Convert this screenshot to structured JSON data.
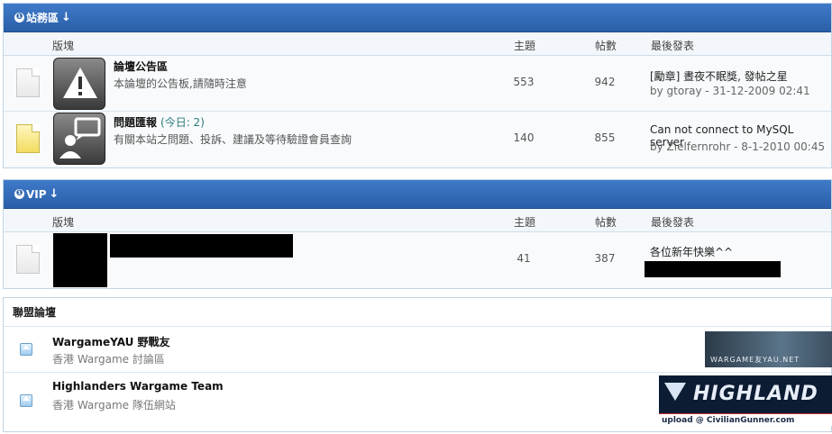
{
  "categories": [
    {
      "title": "站務區",
      "columns": {
        "forum": "版塊",
        "topics": "主題",
        "posts": "帖數",
        "last": "最後發表"
      },
      "forums": [
        {
          "title": "論壇公告區",
          "today": "",
          "desc": "本論壇的公告板,請隨時注意",
          "topics": "553",
          "posts": "942",
          "last_title": "[勵章] 晝夜不眠獎, 發帖之星",
          "last_by": "by gtoray - 31-12-2009 02:41",
          "icon": "warning-icon",
          "folder": "no-new"
        },
        {
          "title": "問題匯報",
          "today": "(今日: 2)",
          "desc": "有關本站之問題、投訴、建議及等待驗證會員查詢",
          "topics": "140",
          "posts": "855",
          "last_title": "Can not connect to MySQL server",
          "last_by": "by Zielfernrohr - 8-1-2010 00:45",
          "icon": "feedback-user-icon",
          "folder": "new"
        }
      ]
    },
    {
      "title": "VIP",
      "columns": {
        "forum": "版塊",
        "topics": "主題",
        "posts": "帖數",
        "last": "最後發表"
      },
      "forums": [
        {
          "title": "",
          "desc": "",
          "topics": "41",
          "posts": "387",
          "last_title": "各位新年快樂^^",
          "last_by": "",
          "icon": "redacted",
          "folder": "no-new"
        }
      ]
    }
  ],
  "partners": {
    "title": "聯盟論壇",
    "items": [
      {
        "title": "WargameYAU 野戰友",
        "desc": "香港 Wargame 討論區",
        "banner_text": "WARGAME友YAU.NET"
      },
      {
        "title": "Highlanders Wargame Team",
        "desc": "香港 Wargame 隊伍網站",
        "banner_text": "HIGHLAND",
        "banner_sub": "upload @ CivilianGunner.com"
      }
    ]
  }
}
